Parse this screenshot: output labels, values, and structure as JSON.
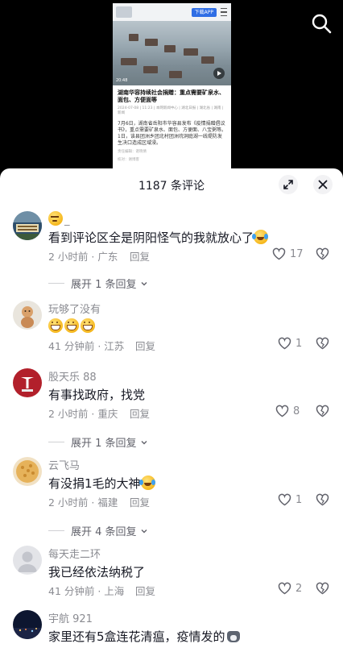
{
  "video": {
    "download_label": "下载APP",
    "photo_timestamp": "20:48",
    "headline": "湖南华容持续社会捐赠：重点需要矿泉水、面包、方便面等",
    "meta": "2024-07-08 | 11:23 | 本网新闻中心 | 湖北日报 | 湖北省 | 湖南 | 新闻",
    "body": "7月6日，湖南省岳阳市华容县发布《疫情捐赠倡议书》，重点需要矿泉水、面包、方便面、八宝粥等。1日，该县团洲乡团北村团洲垸洞庭湖一线堤防发生决口造成区域浸。",
    "footer": "责任编辑：谌晓倩",
    "footer2": "校对：谢博客"
  },
  "sheet": {
    "title": "1187 条评论"
  },
  "comments": [
    {
      "name": "_",
      "text": "看到评论区全是阴阳怪气的我就放心了",
      "time_location": "2 小时前 · 广东",
      "reply": "回复",
      "likes": "17",
      "expand": "展开 1 条回复"
    },
    {
      "name": "玩够了没有",
      "text": "",
      "time_location": "41 分钟前 · 江苏",
      "reply": "回复",
      "likes": "1",
      "expand": ""
    },
    {
      "name": "股天乐 88",
      "text": "有事找政府，找党",
      "time_location": "2 小时前 · 重庆",
      "reply": "回复",
      "likes": "8",
      "expand": "展开 1 条回复"
    },
    {
      "name": "云飞马",
      "text": "有没捐1毛的大神",
      "time_location": "2 小时前 · 福建",
      "reply": "回复",
      "likes": "1",
      "expand": "展开 4 条回复"
    },
    {
      "name": "每天走二环",
      "text": "我已经依法纳税了",
      "time_location": "41 分钟前 · 上海",
      "reply": "回复",
      "likes": "2",
      "expand": ""
    },
    {
      "name": "宇航 921",
      "text": "家里还有5盒连花清瘟，疫情发的",
      "time_location": "",
      "reply": "",
      "likes": "",
      "expand": ""
    }
  ],
  "icons": {
    "search": "search-icon",
    "expand": "expand-icon",
    "close": "close-icon",
    "like": "heart-icon",
    "dislike": "broken-heart-icon",
    "chevron": "chevron-down-icon"
  }
}
